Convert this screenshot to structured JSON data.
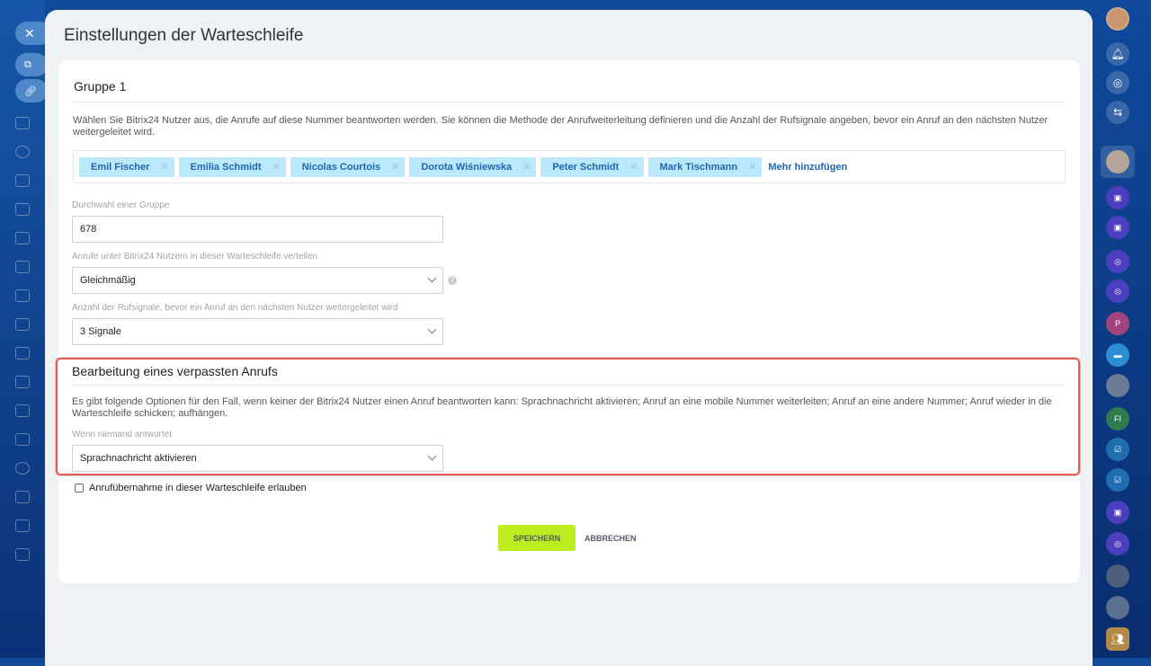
{
  "panel_title": "Einstellungen der Warteschleife",
  "group": {
    "title": "Gruppe 1",
    "description": "Wählen Sie Bitrix24 Nutzer aus, die Anrufe auf diese Nummer beantworten werden. Sie können die Methode der Anrufweiterleitung definieren und die Anzahl der Rufsignale angeben, bevor ein Anruf an den nächsten Nutzer weitergeleitet wird.",
    "users": [
      "Emil Fischer",
      "Emilia Schmidt",
      "Nicolas Courtois",
      "Dorota Wiśniewska",
      "Peter Schmidt",
      "Mark Tischmann"
    ],
    "add_more": "Mehr hinzufügen",
    "extension_label": "Durchwahl einer Gruppe",
    "extension_value": "678",
    "distribution_label": "Anrufe unter Bitrix24 Nutzern in dieser Warteschleife verteilen",
    "distribution_value": "Gleichmäßig",
    "rings_label": "Anzahl der Rufsignale, bevor ein Anruf an den nächsten Nutzer weitergeleitet wird",
    "rings_value": "3 Signale"
  },
  "missed": {
    "title": "Bearbeitung eines verpassten Anrufs",
    "description": "Es gibt folgende Optionen für den Fall, wenn keiner der Bitrix24 Nutzer einen Anruf beantworten kann: Sprachnachricht aktivieren; Anruf an eine mobile Nummer weiterleiten; Anruf an eine andere Nummer; Anruf wieder in die Warteschleife schicken; aufhängen.",
    "no_answer_label": "Wenn niemand antwortet",
    "no_answer_value": "Sprachnachricht aktivieren"
  },
  "pickup_label": "Anrufübernahme in dieser Warteschleife erlauben",
  "pickup_checked": false,
  "buttons": {
    "save": "SPEICHERN",
    "cancel": "ABBRECHEN"
  },
  "rightbar": {
    "initials_p": "P",
    "initials_fi": "FI"
  },
  "colors": {
    "accent": "#bbed21",
    "tag_bg": "#bce8fb",
    "highlight": "#e8584f"
  }
}
